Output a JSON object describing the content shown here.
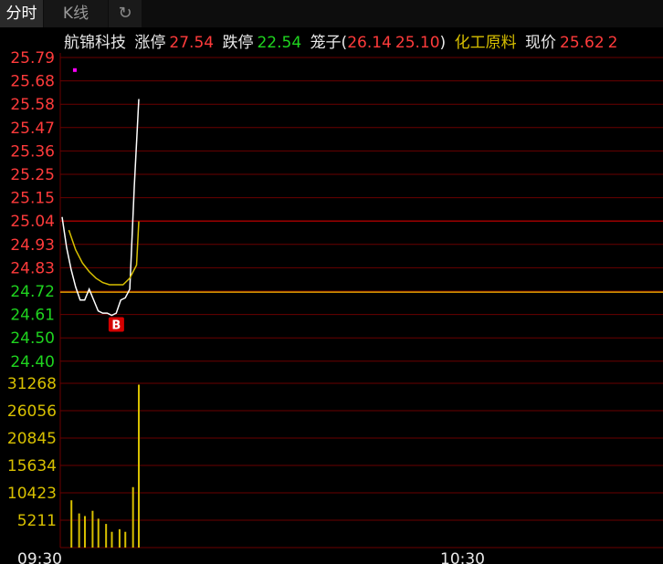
{
  "tabs": {
    "intraday": "分时",
    "kline": "K线",
    "refresh_icon": "refresh-icon"
  },
  "header": {
    "stock_name": "航锦科技",
    "limit_up_label": "涨停",
    "limit_up_value": "27.54",
    "limit_down_label": "跌停",
    "limit_down_value": "22.54",
    "cage_label": "笼子(",
    "cage_high": "26.14",
    "cage_low": "25.10",
    "cage_close": ")",
    "sector": "化工原料",
    "price_label": "现价",
    "price_value": "25.62",
    "price_trunc": "2"
  },
  "colors": {
    "up": "#ff3b3b",
    "down": "#1fd41f",
    "avg": "#d8c000",
    "price_line": "#ffffff",
    "grid": "#6a0000",
    "prev_close_line": "#e0a000",
    "volume": "#d8c000",
    "signal": "#d40000",
    "marker": "#ff00ff"
  },
  "chart_data": {
    "type": "line",
    "price_axis": {
      "ticks": [
        "25.79",
        "25.68",
        "25.58",
        "25.47",
        "25.36",
        "25.25",
        "25.15",
        "25.04",
        "24.93",
        "24.83",
        "24.72",
        "24.61",
        "24.50",
        "24.40"
      ],
      "range": [
        24.4,
        25.79
      ],
      "prev_close": 24.72,
      "up_ticks_above": 24.72
    },
    "volume_axis": {
      "ticks": [
        "31268",
        "26056",
        "20845",
        "15634",
        "10423",
        "5211"
      ],
      "range": [
        0,
        31268
      ]
    },
    "time_axis": {
      "labels": [
        "09:30",
        "10:30"
      ]
    },
    "price_series": {
      "name": "",
      "t": [
        0,
        2,
        4,
        6,
        8,
        10,
        12,
        14,
        16,
        18,
        20,
        22,
        24,
        26,
        28,
        30,
        32,
        34
      ],
      "values": [
        25.06,
        24.92,
        24.82,
        24.74,
        24.68,
        24.68,
        24.73,
        24.68,
        24.63,
        24.62,
        24.62,
        24.61,
        24.62,
        24.68,
        24.69,
        24.73,
        25.2,
        25.6
      ]
    },
    "avg_series": {
      "name": "",
      "t": [
        3,
        6,
        9,
        12,
        15,
        18,
        21,
        24,
        27,
        30,
        33,
        34
      ],
      "values": [
        25.0,
        24.91,
        24.85,
        24.81,
        24.78,
        24.76,
        24.75,
        24.75,
        24.75,
        24.78,
        24.84,
        25.04
      ]
    },
    "volume_series": {
      "t": [
        2,
        6,
        9,
        13,
        16,
        20,
        23,
        27,
        30,
        34,
        37
      ],
      "values": [
        9000,
        6500,
        6000,
        7000,
        5500,
        4500,
        3000,
        3500,
        3000,
        11500,
        31000
      ]
    },
    "signal": {
      "label": "B",
      "t": 21,
      "value": 24.61
    },
    "marker": {
      "t": 2,
      "value": 25.77
    }
  }
}
